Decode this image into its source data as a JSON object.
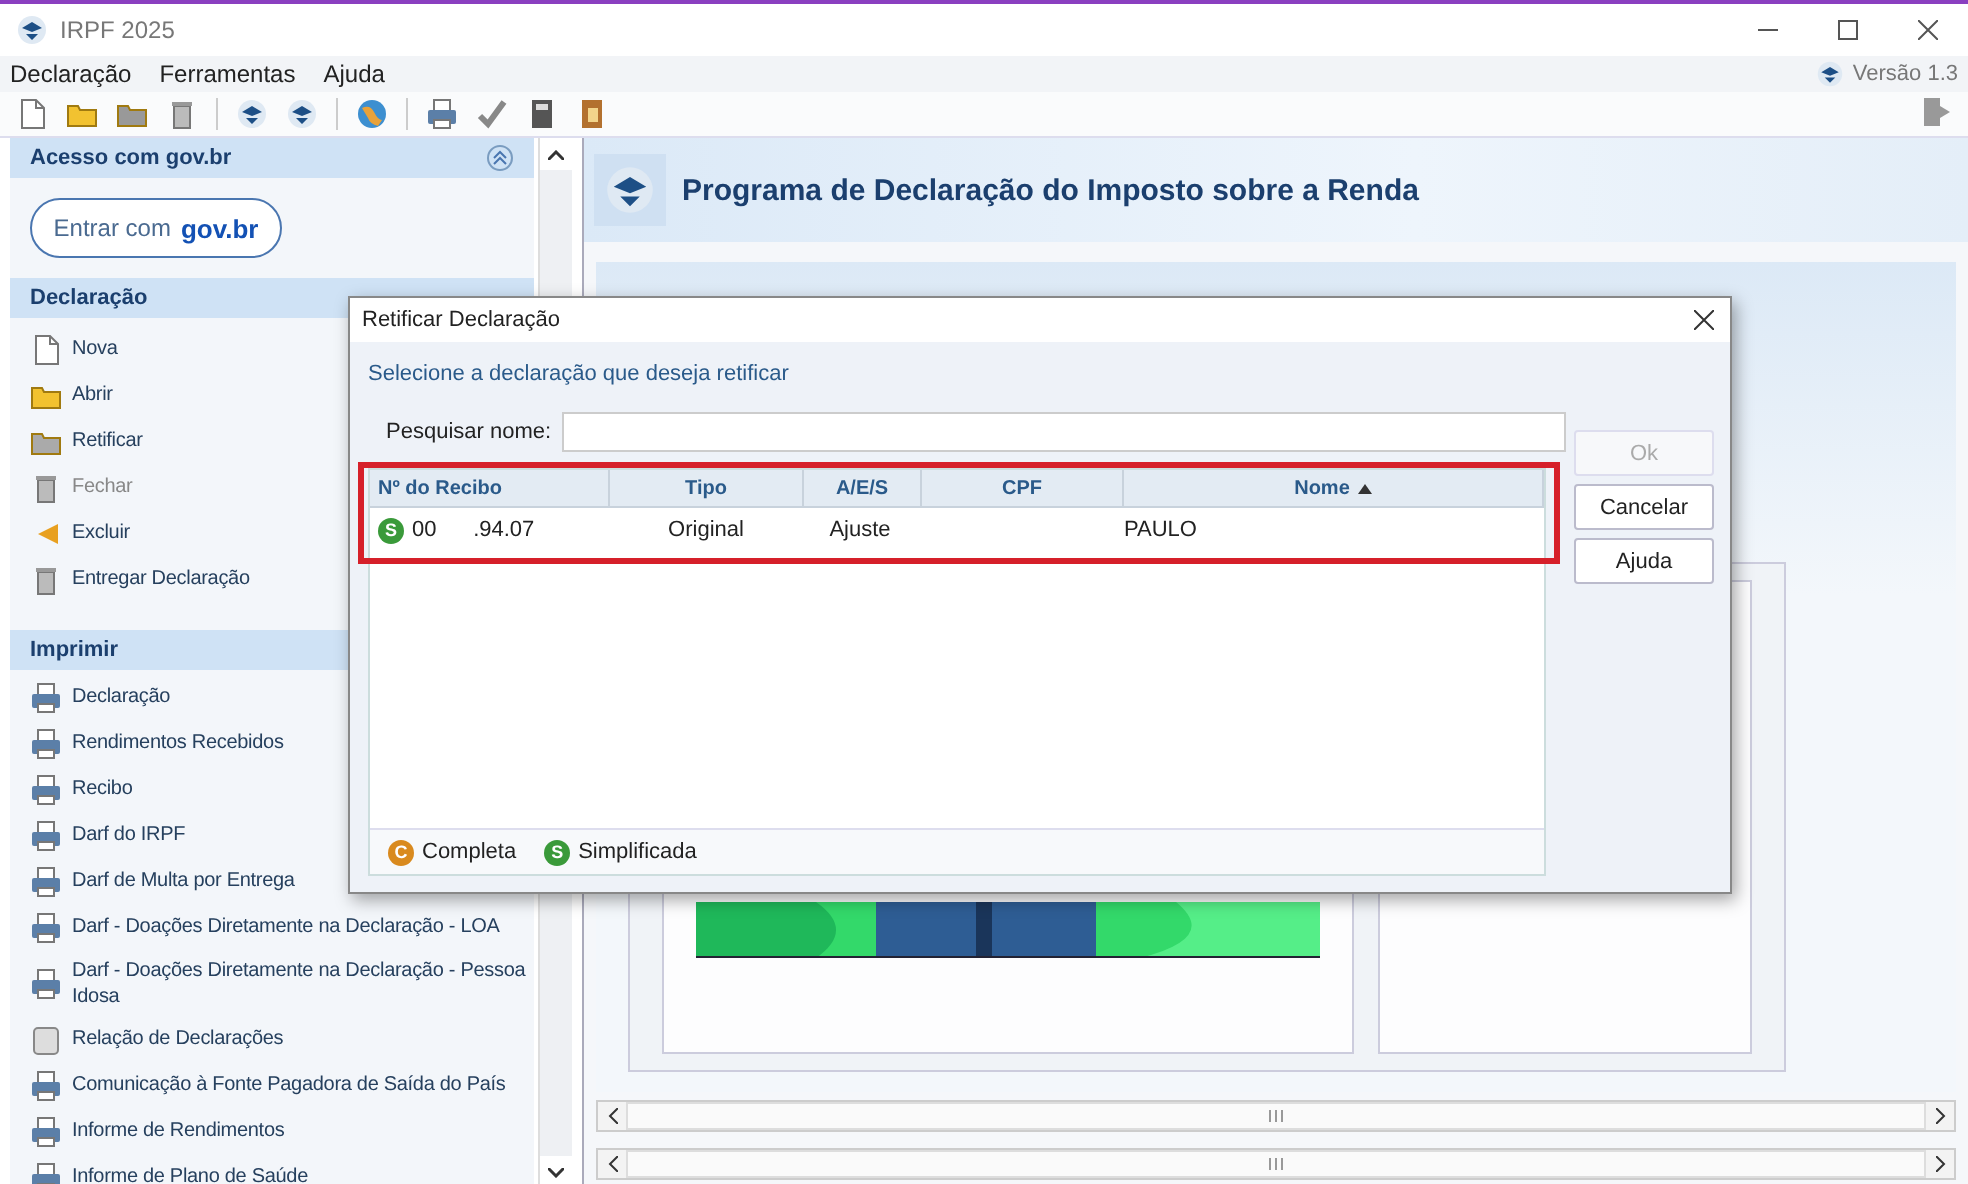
{
  "window": {
    "title": "IRPF 2025"
  },
  "menu": [
    {
      "label": "Declaração"
    },
    {
      "label": "Ferramentas"
    },
    {
      "label": "Ajuda"
    }
  ],
  "version": "Versão 1.3",
  "sidebar": {
    "sections": [
      {
        "kind": "login",
        "title": "Acesso com gov.br",
        "button_text": "Entrar com",
        "button_brand": "gov.br"
      },
      {
        "kind": "list",
        "title": "Declaração",
        "items": [
          {
            "label": "Nova",
            "disabled": false
          },
          {
            "label": "Abrir",
            "disabled": false
          },
          {
            "label": "Retificar",
            "disabled": false
          },
          {
            "label": "Fechar",
            "disabled": true
          },
          {
            "label": "Excluir",
            "disabled": false
          },
          {
            "label": "Entregar Declaração",
            "disabled": false
          }
        ]
      },
      {
        "kind": "list",
        "title": "Imprimir",
        "items": [
          {
            "label": "Declaração",
            "disabled": false
          },
          {
            "label": "Rendimentos Recebidos",
            "disabled": false
          },
          {
            "label": "Recibo",
            "disabled": false
          },
          {
            "label": "Darf do IRPF",
            "disabled": false
          },
          {
            "label": "Darf de Multa por Entrega",
            "disabled": false
          },
          {
            "label": "Darf - Doações Diretamente na Declaração - LOA",
            "disabled": false
          },
          {
            "label": "Darf - Doações Diretamente na Declaração - Pessoa Idosa",
            "disabled": false
          },
          {
            "label": "Relação de Declarações",
            "disabled": false
          },
          {
            "label": "Comunicação à Fonte Pagadora de Saída do País",
            "disabled": false
          },
          {
            "label": "Informe de Rendimentos",
            "disabled": false
          },
          {
            "label": "Informe de Plano de Saúde",
            "disabled": false
          }
        ]
      }
    ]
  },
  "main": {
    "title": "Programa de Declaração do Imposto sobre a Renda"
  },
  "dialog": {
    "title": "Retificar Declaração",
    "instruction": "Selecione a declaração que deseja retificar",
    "search": {
      "label": "Pesquisar nome:"
    },
    "table": {
      "columns": [
        {
          "label": "Nº do Recibo",
          "sorted": false
        },
        {
          "label": "Tipo",
          "sorted": false
        },
        {
          "label": "A/E/S",
          "sorted": false
        },
        {
          "label": "CPF",
          "sorted": false
        },
        {
          "label": "Nome",
          "sorted": true
        }
      ],
      "rows": [
        {
          "badge": "S",
          "color": "#3a9a3a",
          "cells": [
            "00      .94.07",
            "Original",
            "Ajuste",
            "",
            "PAULO"
          ]
        }
      ]
    },
    "legend": [
      {
        "letter": "C",
        "label": "Completa",
        "color": "#d98a1e"
      },
      {
        "letter": "S",
        "label": "Simplificada",
        "color": "#3a9a3a"
      }
    ],
    "buttons": [
      {
        "label": "Ok",
        "disabled": true
      },
      {
        "label": "Cancelar",
        "disabled": false
      },
      {
        "label": "Ajuda",
        "disabled": false
      }
    ]
  }
}
